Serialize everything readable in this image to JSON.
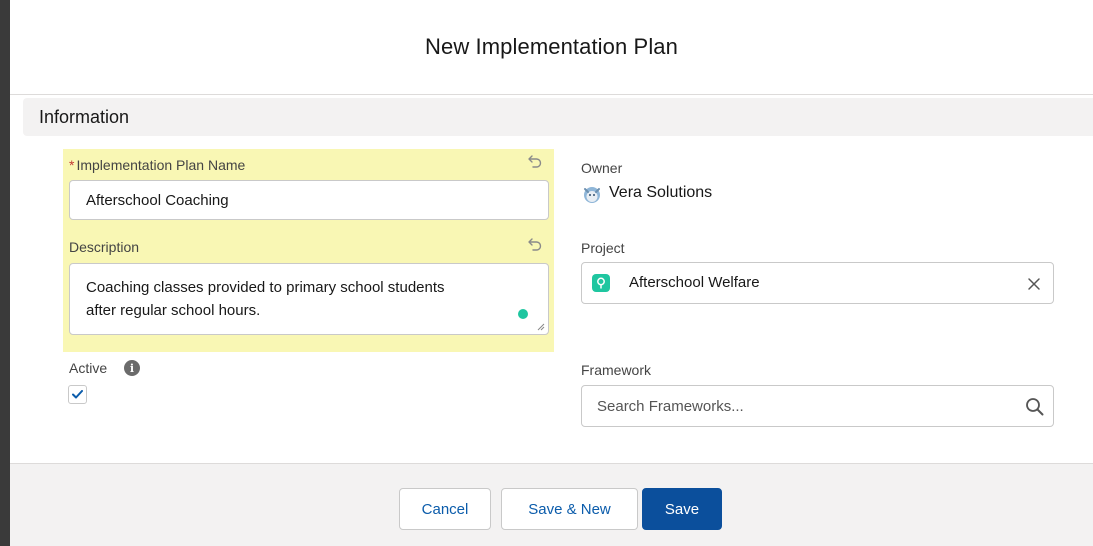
{
  "modal": {
    "title": "New Implementation Plan"
  },
  "section": {
    "title": "Information"
  },
  "fields": {
    "name": {
      "required_marker": "*",
      "label": "Implementation Plan Name",
      "value": "Afterschool Coaching"
    },
    "description": {
      "label": "Description",
      "value_line1": "Coaching classes provided to primary school students",
      "value_line2": "after regular school hours."
    },
    "active": {
      "label": "Active",
      "info_glyph": "i",
      "checked": true
    },
    "owner": {
      "label": "Owner",
      "value": "Vera Solutions"
    },
    "project": {
      "label": "Project",
      "value": "Afterschool Welfare"
    },
    "framework": {
      "label": "Framework",
      "placeholder": "Search Frameworks..."
    }
  },
  "footer": {
    "cancel_label": "Cancel",
    "save_new_label": "Save & New",
    "save_label": "Save"
  },
  "colors": {
    "highlight": "#f9f7b4",
    "brand": "#0b4f9c",
    "project_icon": "#1fc6a0",
    "required": "#c23934"
  },
  "icons": [
    "undo-icon",
    "info-icon",
    "check-icon",
    "owner-avatar-icon",
    "project-icon",
    "clear-icon",
    "search-icon",
    "resize-handle-icon"
  ]
}
